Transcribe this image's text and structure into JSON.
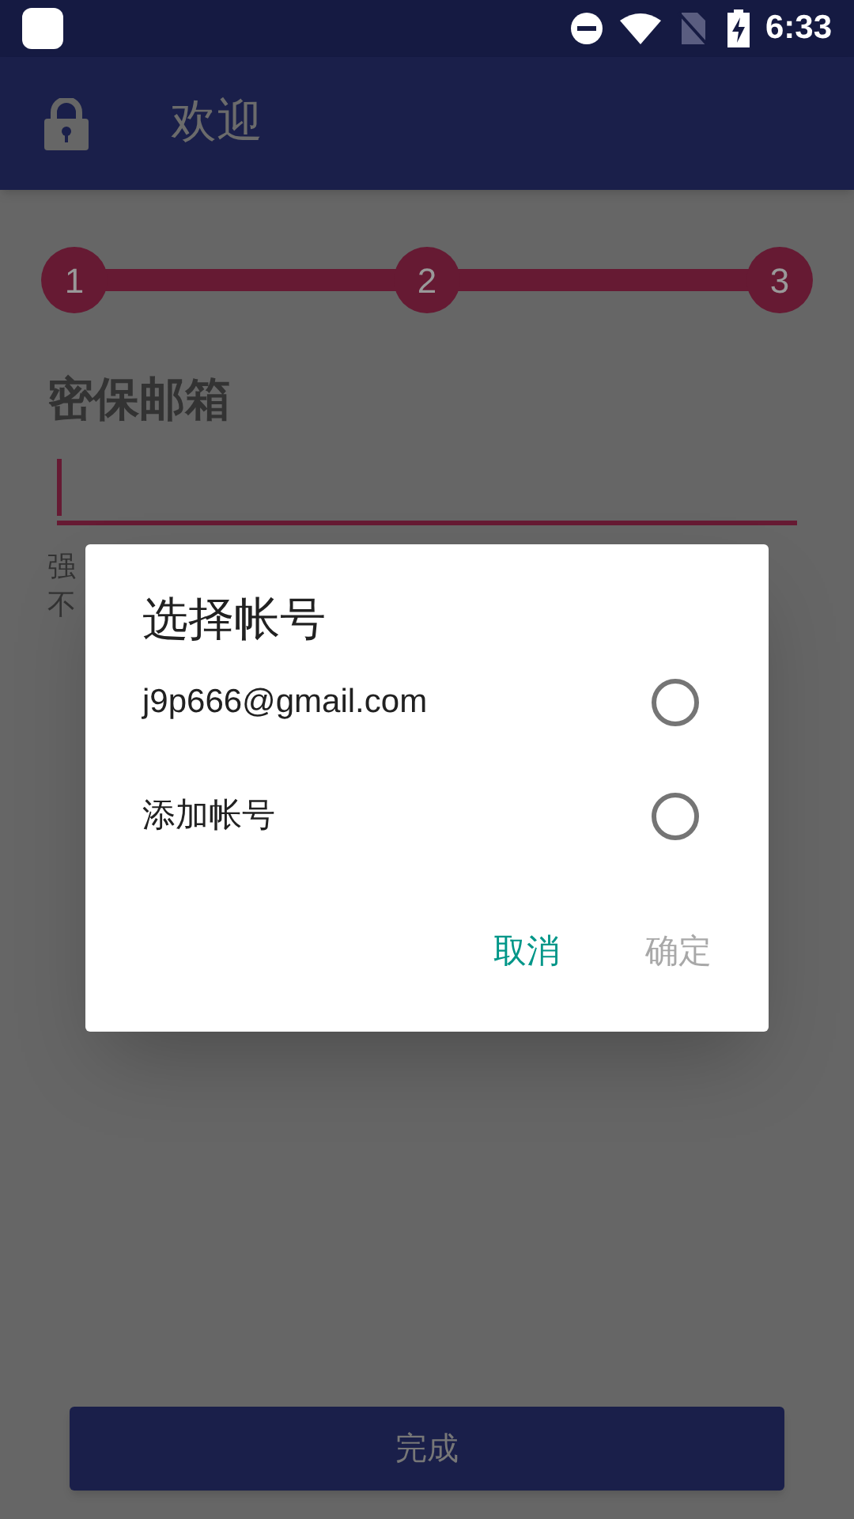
{
  "status_bar": {
    "time": "6:33"
  },
  "app_bar": {
    "title": "欢迎"
  },
  "stepper": {
    "steps": [
      "1",
      "2",
      "3"
    ]
  },
  "form": {
    "label": "密保邮箱",
    "hint_lines": [
      "强",
      "不"
    ]
  },
  "dialog": {
    "title": "选择帐号",
    "options": [
      {
        "label": "j9p666@gmail.com",
        "selected": false
      },
      {
        "label": "添加帐号",
        "selected": false
      }
    ],
    "buttons": [
      {
        "label": "取消",
        "disabled": false
      },
      {
        "label": "确定",
        "disabled": true
      }
    ]
  },
  "bottom_button": {
    "label": "完成"
  }
}
